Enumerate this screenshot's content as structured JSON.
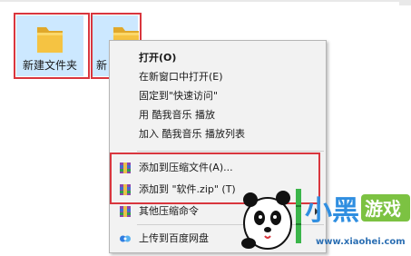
{
  "desktop": {
    "folders": [
      {
        "label": "新建文件夹",
        "selected": true
      },
      {
        "label": "新",
        "selected": true
      }
    ]
  },
  "context_menu": {
    "items": [
      {
        "label": "打开(O)",
        "bold": true
      },
      {
        "label": "在新窗口中打开(E)"
      },
      {
        "label": "固定到\"快速访问\""
      },
      {
        "label": "用 酷我音乐 播放"
      },
      {
        "label": "加入 酷我音乐 播放列表"
      },
      {
        "label": "添加到压缩文件(A)...",
        "icon": "winrar-archive-icon"
      },
      {
        "label": "添加到 \"软件.zip\" (T)",
        "icon": "winrar-archive-icon"
      },
      {
        "label": "其他压缩命令",
        "icon": "winrar-archive-icon",
        "has_submenu": true
      },
      {
        "label": "上传到百度网盘",
        "icon": "baidu-netdisk-icon"
      }
    ]
  },
  "watermark": {
    "brand": "小黑游戏",
    "site": "www.xiaohei.com",
    "bg_site": "xiaohei.com"
  },
  "colors": {
    "selection": "#cce8ff",
    "highlight_box": "#d9363e",
    "folder_yellow": "#f5c342",
    "menu_bg": "#f2f2f2"
  }
}
